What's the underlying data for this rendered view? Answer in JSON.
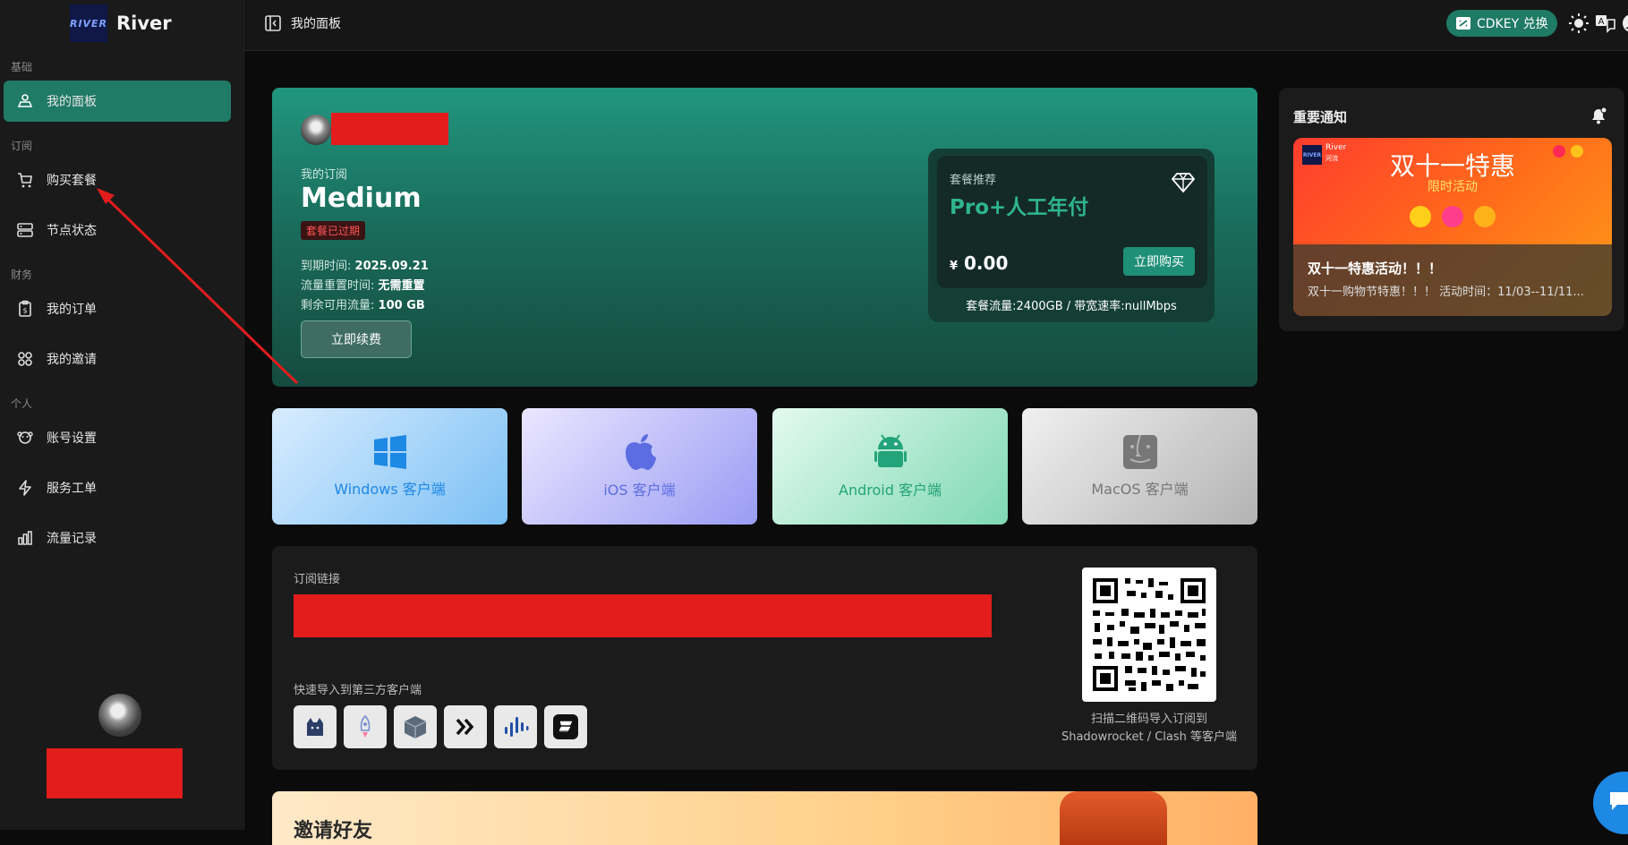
{
  "brand": {
    "logo_text": "RIVER",
    "name": "River"
  },
  "sidebar": {
    "sections": [
      {
        "label": "基础",
        "items": [
          {
            "label": "我的面板",
            "icon": "dashboard-icon",
            "active": true
          }
        ]
      },
      {
        "label": "订阅",
        "items": [
          {
            "label": "购买套餐",
            "icon": "cart-icon"
          },
          {
            "label": "节点状态",
            "icon": "server-icon"
          }
        ]
      },
      {
        "label": "财务",
        "items": [
          {
            "label": "我的订单",
            "icon": "order-icon"
          },
          {
            "label": "我的邀请",
            "icon": "invite-icon"
          }
        ]
      },
      {
        "label": "个人",
        "items": [
          {
            "label": "账号设置",
            "icon": "settings-icon"
          },
          {
            "label": "服务工单",
            "icon": "ticket-icon"
          },
          {
            "label": "流量记录",
            "icon": "chart-icon"
          }
        ]
      }
    ]
  },
  "topbar": {
    "title": "我的面板",
    "cdkey_label": "CDKEY 兑换"
  },
  "subscription": {
    "section_label": "我的订阅",
    "plan_name": "Medium",
    "status_badge": "套餐已过期",
    "expire_label": "到期时间:",
    "expire_value": "2025.09.21",
    "reset_label": "流量重置时间:",
    "reset_value": "无需重置",
    "remaining_label": "剩余可用流量:",
    "remaining_value": "100 GB",
    "renew_button": "立即续费"
  },
  "recommend": {
    "label": "套餐推荐",
    "plan": "Pro+人工年付",
    "currency": "¥",
    "price": "0.00",
    "buy_button": "立即购买",
    "details": "套餐流量:2400GB / 带宽速率:nullMbps"
  },
  "notice": {
    "title": "重要通知",
    "banner_brand": "River",
    "banner_brand_sub": "河流",
    "banner_title": "双十一特惠",
    "banner_subtitle": "限时活动",
    "item_title": "双十一特惠活动！！！",
    "item_desc": "双十一购物节特惠！！！ 活动时间：11/03--11/11..."
  },
  "clients": [
    {
      "label": "Windows 客户端",
      "icon": "windows-icon",
      "color": "#1e88e5"
    },
    {
      "label": "iOS 客户端",
      "icon": "apple-icon",
      "color": "#5b6de0"
    },
    {
      "label": "Android 客户端",
      "icon": "android-icon",
      "color": "#23a37a"
    },
    {
      "label": "MacOS 客户端",
      "icon": "finder-icon",
      "color": "#777777"
    }
  ],
  "subscribe_link": {
    "label": "订阅链接",
    "quick_import_label": "快速导入到第三方客户端",
    "qr_caption_line1": "扫描二维码导入订阅到",
    "qr_caption_line2": "Shadowrocket / Clash 等客户端"
  },
  "invite": {
    "title": "邀请好友"
  }
}
